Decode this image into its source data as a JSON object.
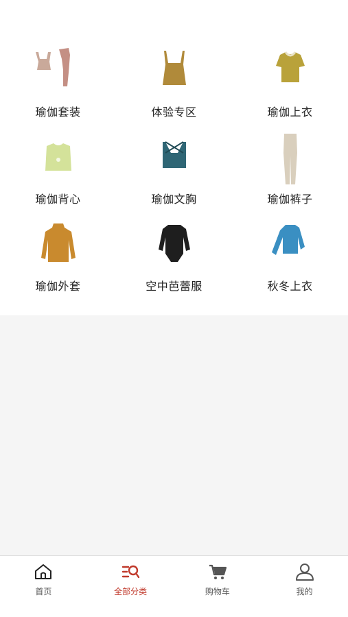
{
  "categories": [
    {
      "label": "瑜伽套装",
      "icon": "yoga-set-image",
      "color": "#c9a99a"
    },
    {
      "label": "体验专区",
      "icon": "tank-top-image",
      "color": "#b08a3a"
    },
    {
      "label": "瑜伽上衣",
      "icon": "tshirt-image",
      "color": "#b9a23a"
    },
    {
      "label": "瑜伽背心",
      "icon": "crop-top-image",
      "color": "#d4e29a"
    },
    {
      "label": "瑜伽文胸",
      "icon": "sports-bra-image",
      "color": "#2f6675"
    },
    {
      "label": "瑜伽裤子",
      "icon": "leggings-image",
      "color": "#d9cfbd"
    },
    {
      "label": "瑜伽外套",
      "icon": "jacket-image",
      "color": "#c98a2e"
    },
    {
      "label": "空中芭蕾服",
      "icon": "bodysuit-image",
      "color": "#1e1e1e"
    },
    {
      "label": "秋冬上衣",
      "icon": "long-sleeve-top-image",
      "color": "#3a8fc2"
    }
  ],
  "tabbar": {
    "items": [
      {
        "label": "首页",
        "icon": "home-icon",
        "active": false
      },
      {
        "label": "全部分类",
        "icon": "category-search-icon",
        "active": true
      },
      {
        "label": "购物车",
        "icon": "cart-icon",
        "active": false
      },
      {
        "label": "我的",
        "icon": "user-icon",
        "active": false
      }
    ],
    "active_color": "#c0392b",
    "inactive_color": "#555555"
  }
}
